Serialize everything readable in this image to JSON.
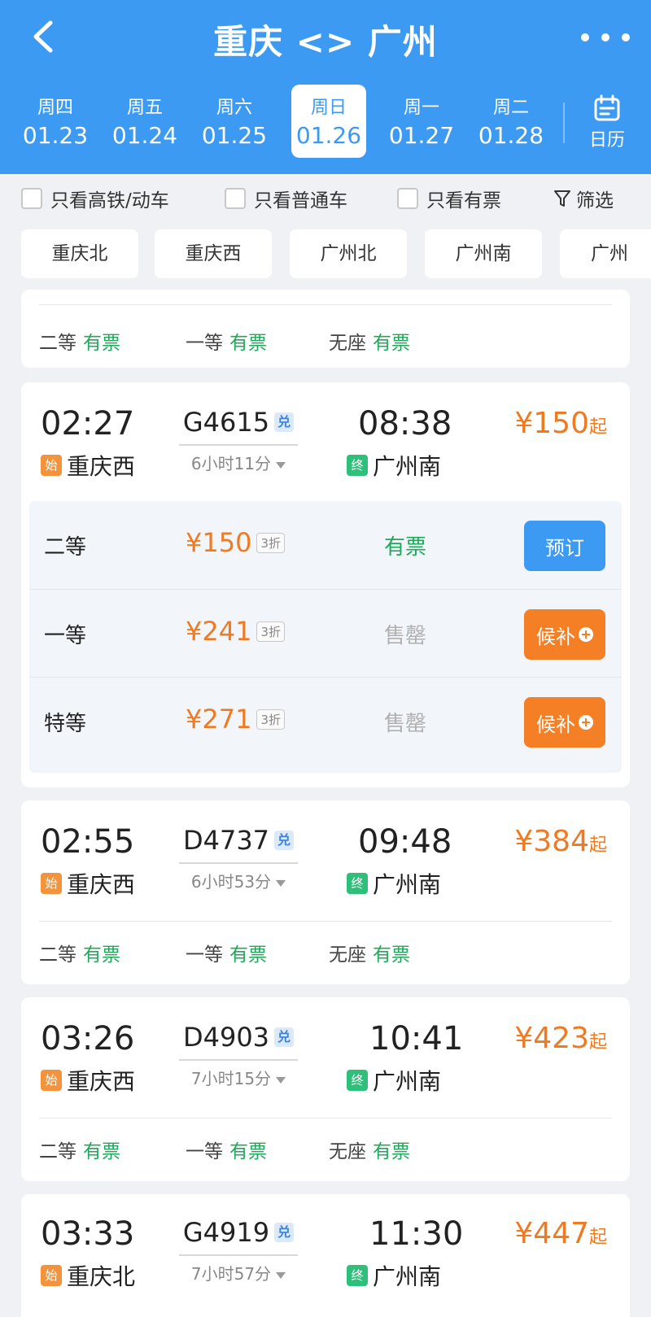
{
  "header": {
    "title": "重庆 <> 广州",
    "days": [
      {
        "week": "周四",
        "date": "01.23"
      },
      {
        "week": "周五",
        "date": "01.24"
      },
      {
        "week": "周六",
        "date": "01.25"
      },
      {
        "week": "周日",
        "date": "01.26"
      },
      {
        "week": "周一",
        "date": "01.27"
      },
      {
        "week": "周二",
        "date": "01.28"
      }
    ],
    "calendar_label": "日历"
  },
  "filters": {
    "highspeed": "只看高铁/动车",
    "normal": "只看普通车",
    "available": "只看有票",
    "filter": "筛选"
  },
  "stations": [
    "重庆北",
    "重庆西",
    "广州北",
    "广州南",
    "广州"
  ],
  "partial_card": {
    "seats": [
      {
        "name": "二等",
        "status": "有票"
      },
      {
        "name": "一等",
        "status": "有票"
      },
      {
        "name": "无座",
        "status": "有票"
      }
    ]
  },
  "trains": [
    {
      "depart": "02:27",
      "train_no": "G4615",
      "badge": "兑",
      "duration": "6小时11分",
      "arrive": "08:38",
      "from_tag": "始",
      "from": "重庆西",
      "to_tag": "终",
      "to": "广州南",
      "price": "¥150",
      "price_suffix": "起",
      "seat_details": [
        {
          "name": "二等",
          "price": "¥150",
          "discount": "3折",
          "status": "有票",
          "button": "预订"
        },
        {
          "name": "一等",
          "price": "¥241",
          "discount": "3折",
          "status": "售罄",
          "button": "候补"
        },
        {
          "name": "特等",
          "price": "¥271",
          "discount": "3折",
          "status": "售罄",
          "button": "候补"
        }
      ]
    },
    {
      "depart": "02:55",
      "train_no": "D4737",
      "badge": "兑",
      "duration": "6小时53分",
      "arrive": "09:48",
      "from_tag": "始",
      "from": "重庆西",
      "to_tag": "终",
      "to": "广州南",
      "price": "¥384",
      "price_suffix": "起",
      "seats": [
        {
          "name": "二等",
          "status": "有票"
        },
        {
          "name": "一等",
          "status": "有票"
        },
        {
          "name": "无座",
          "status": "有票"
        }
      ]
    },
    {
      "depart": "03:26",
      "train_no": "D4903",
      "badge": "兑",
      "duration": "7小时15分",
      "arrive": "10:41",
      "from_tag": "始",
      "from": "重庆西",
      "to_tag": "终",
      "to": "广州南",
      "price": "¥423",
      "price_suffix": "起",
      "seats": [
        {
          "name": "二等",
          "status": "有票"
        },
        {
          "name": "一等",
          "status": "有票"
        },
        {
          "name": "无座",
          "status": "有票"
        }
      ]
    },
    {
      "depart": "03:33",
      "train_no": "G4919",
      "badge": "兑",
      "duration": "7小时57分",
      "arrive": "11:30",
      "from_tag": "始",
      "from": "重庆北",
      "to_tag": "终",
      "to": "广州南",
      "price": "¥447",
      "price_suffix": "起"
    }
  ],
  "colors": {
    "header_blue": "#3c9af2",
    "price_orange": "#f07a22",
    "available_green": "#20a85a",
    "soldout_gray": "#b0b0b0",
    "waitlist_orange": "#f57f25"
  }
}
